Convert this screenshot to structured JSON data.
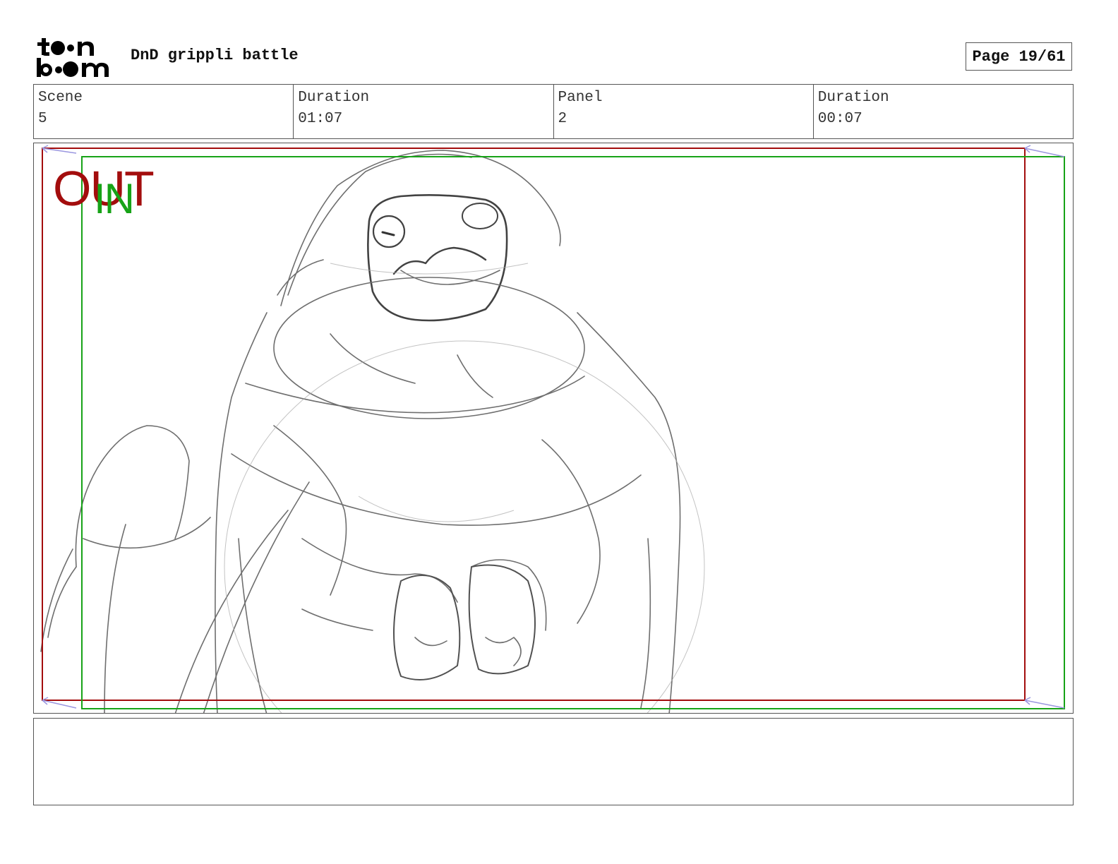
{
  "header": {
    "logo_text": "toon boom",
    "project_title": "DnD grippli battle",
    "page_label": "Page 19/61"
  },
  "info": {
    "scene_label": "Scene",
    "scene_value": "5",
    "scene_duration_label": "Duration",
    "scene_duration_value": "01:07",
    "panel_label": "Panel",
    "panel_value": "2",
    "panel_duration_label": "Duration",
    "panel_duration_value": "00:07"
  },
  "panel": {
    "out_label": "OUT",
    "in_label": "IN",
    "out_frame_color": "#a30d0d",
    "in_frame_color": "#17a317",
    "sketch_subject": "grippli character pencil sketch"
  },
  "caption": {
    "text": ""
  }
}
